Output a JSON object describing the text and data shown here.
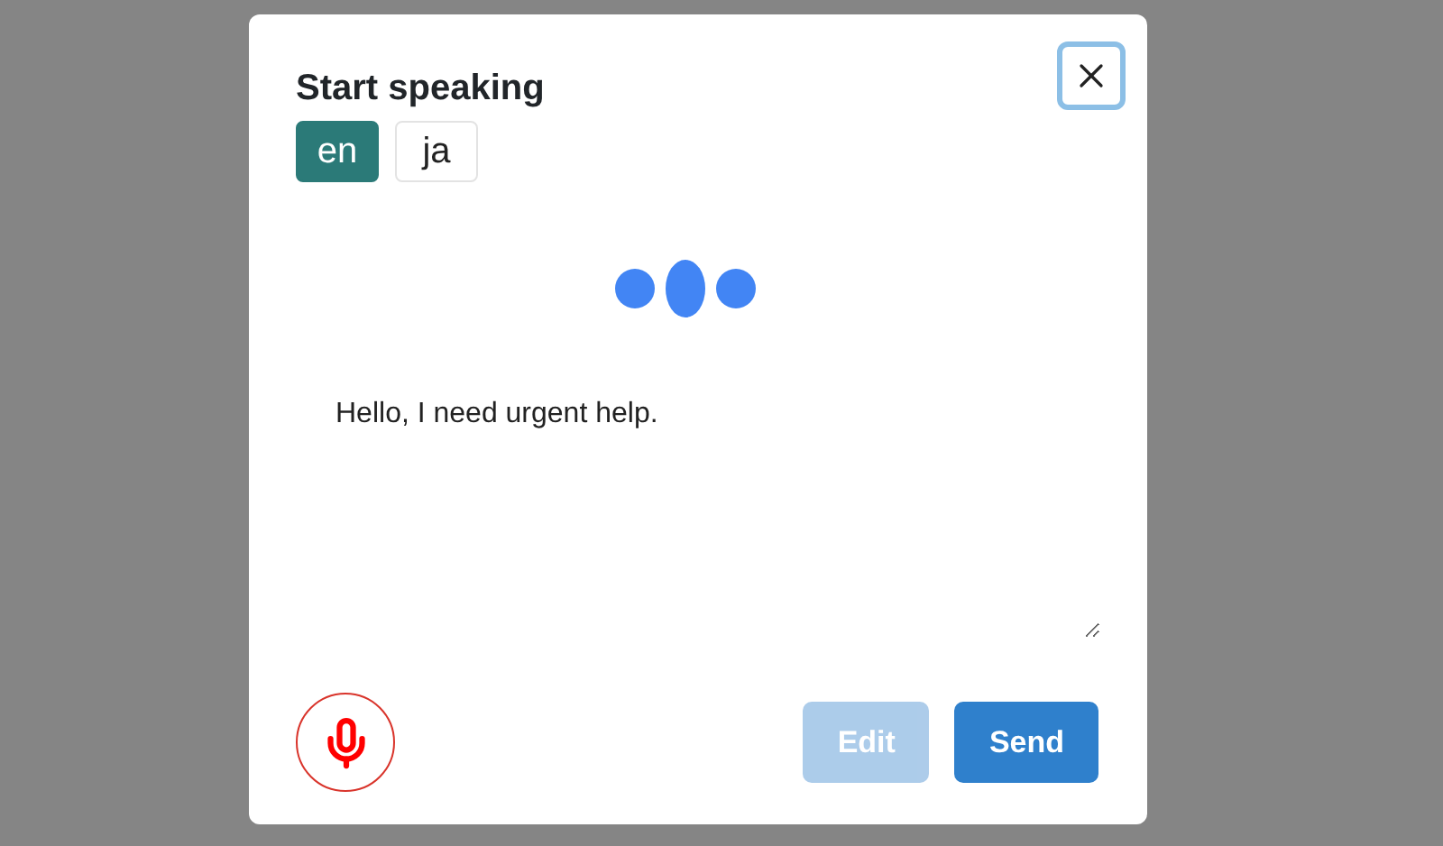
{
  "dialog": {
    "title": "Start speaking",
    "languages": [
      {
        "label": "en",
        "selected": true
      },
      {
        "label": "ja",
        "selected": false
      }
    ],
    "listening": true,
    "message": {
      "value": "Hello, I need urgent help."
    },
    "microphone": {
      "recording": true
    },
    "buttons": [
      {
        "label": "Edit",
        "kind": "secondary",
        "disabled": true
      },
      {
        "label": "Send",
        "kind": "primary",
        "disabled": false
      }
    ]
  }
}
